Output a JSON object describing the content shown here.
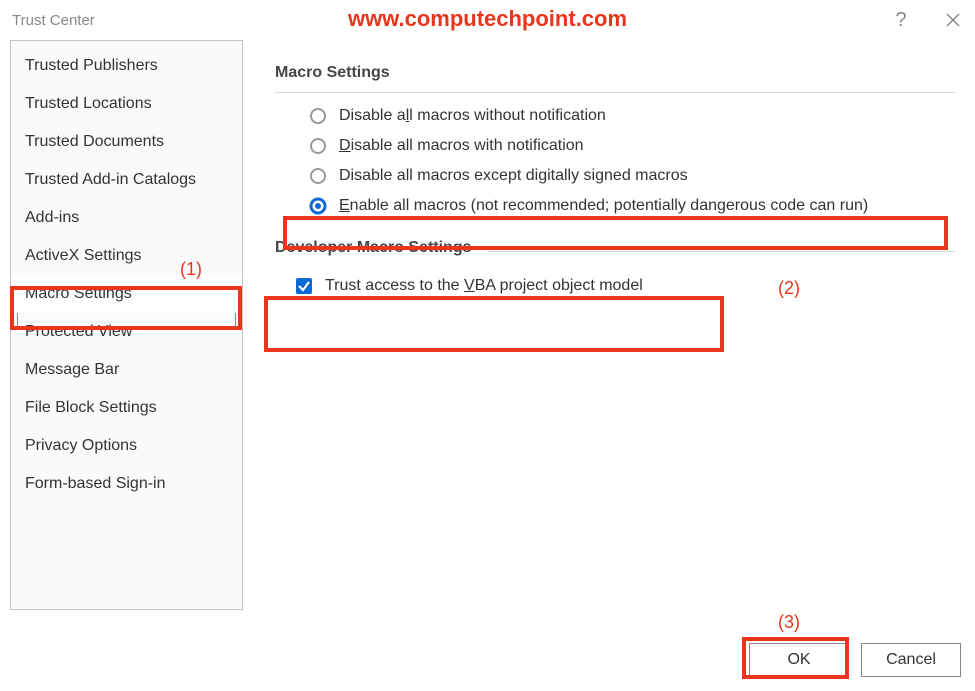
{
  "titlebar": {
    "title": "Trust Center"
  },
  "watermark": "www.computechpoint.com",
  "sidebar": {
    "selected_index": 6,
    "items": [
      {
        "label": "Trusted Publishers"
      },
      {
        "label": "Trusted Locations"
      },
      {
        "label": "Trusted Documents"
      },
      {
        "label": "Trusted Add-in Catalogs"
      },
      {
        "label": "Add-ins"
      },
      {
        "label": "ActiveX Settings"
      },
      {
        "label": "Macro Settings"
      },
      {
        "label": "Protected View"
      },
      {
        "label": "Message Bar"
      },
      {
        "label": "File Block Settings"
      },
      {
        "label": "Privacy Options"
      },
      {
        "label": "Form-based Sign-in"
      }
    ]
  },
  "content": {
    "macro_heading": "Macro Settings",
    "options": [
      {
        "pre": "Disable a",
        "u": "l",
        "post": "l macros without notification",
        "checked": false
      },
      {
        "pre": "",
        "u": "D",
        "post": "isable all macros with notification",
        "checked": false
      },
      {
        "pre": "Disable all macros except digitally si",
        "u": "g",
        "post": "ned macros",
        "checked": false
      },
      {
        "pre": "",
        "u": "E",
        "post": "nable all macros (not recommended; potentially dangerous code can run)",
        "checked": true
      }
    ],
    "dev_heading": "Developer Macro Settings",
    "trust_vba": {
      "pre": "Trust access to the ",
      "u": "V",
      "post": "BA project object model",
      "checked": true
    }
  },
  "buttons": {
    "ok": "OK",
    "cancel": "Cancel"
  },
  "annotations": {
    "a1": "(1)",
    "a2": "(2)",
    "a3": "(3)"
  }
}
